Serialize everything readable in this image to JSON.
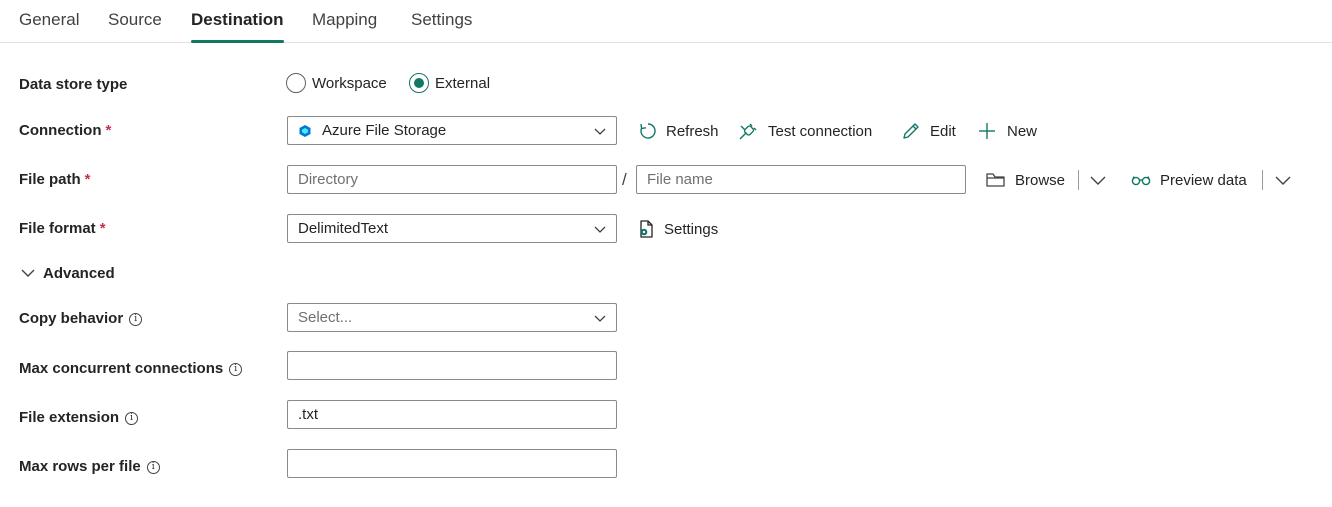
{
  "tabs": [
    {
      "label": "General"
    },
    {
      "label": "Source"
    },
    {
      "label": "Destination"
    },
    {
      "label": "Mapping"
    },
    {
      "label": "Settings"
    }
  ],
  "data_store_type": {
    "label": "Data store type",
    "options": [
      {
        "label": "Workspace"
      },
      {
        "label": "External"
      }
    ],
    "selected": "External"
  },
  "connection": {
    "label": "Connection",
    "required_mark": "*",
    "value": "Azure File Storage",
    "actions": {
      "refresh": "Refresh",
      "test": "Test connection",
      "edit": "Edit",
      "new": "New"
    }
  },
  "file_path": {
    "label": "File path",
    "required_mark": "*",
    "directory_placeholder": "Directory",
    "separator": "/",
    "file_name_placeholder": "File name",
    "browse": "Browse",
    "preview": "Preview data"
  },
  "file_format": {
    "label": "File format",
    "required_mark": "*",
    "value": "DelimitedText",
    "settings": "Settings"
  },
  "advanced": {
    "label": "Advanced"
  },
  "copy_behavior": {
    "label": "Copy behavior",
    "placeholder": "Select..."
  },
  "max_concurrent": {
    "label": "Max concurrent connections",
    "value": ""
  },
  "file_extension": {
    "label": "File extension",
    "value": ".txt"
  },
  "max_rows": {
    "label": "Max rows per file",
    "value": ""
  },
  "colors": {
    "accent": "#117865",
    "required": "#c4314b",
    "border": "#8a8a8a",
    "connection_icon": "#0078d4"
  }
}
